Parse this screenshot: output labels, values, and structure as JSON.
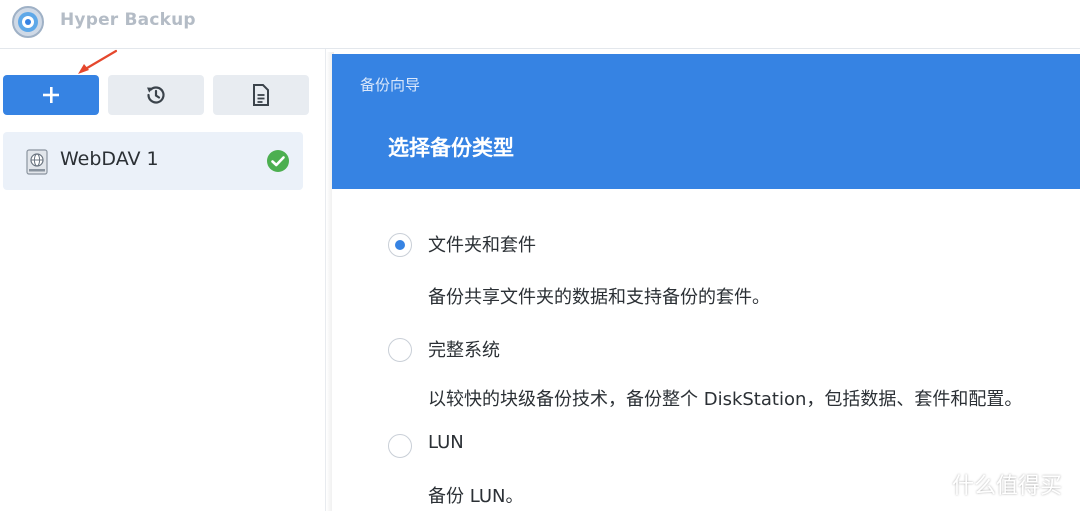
{
  "app": {
    "title": "Hyper Backup"
  },
  "toolbar": {
    "add_icon": "plus-icon",
    "history_icon": "history-icon",
    "log_icon": "document-icon"
  },
  "tasks": [
    {
      "label": "WebDAV 1",
      "icon": "webdav-drive-icon",
      "status": "success"
    }
  ],
  "wizard": {
    "subtitle": "备份向导",
    "title": "选择备份类型",
    "options": [
      {
        "label": "文件夹和套件",
        "description": "备份共享文件夹的数据和支持备份的套件。",
        "selected": true
      },
      {
        "label": "完整系统",
        "description": "以较快的块级备份技术，备份整个 DiskStation，包括数据、套件和配置。",
        "selected": false
      },
      {
        "label": "LUN",
        "description": "备份 LUN。",
        "selected": false
      }
    ]
  },
  "watermark": {
    "text": "什么值得买"
  },
  "colors": {
    "accent": "#3683e3",
    "success": "#4caf50",
    "annotation": "#e5472d"
  }
}
